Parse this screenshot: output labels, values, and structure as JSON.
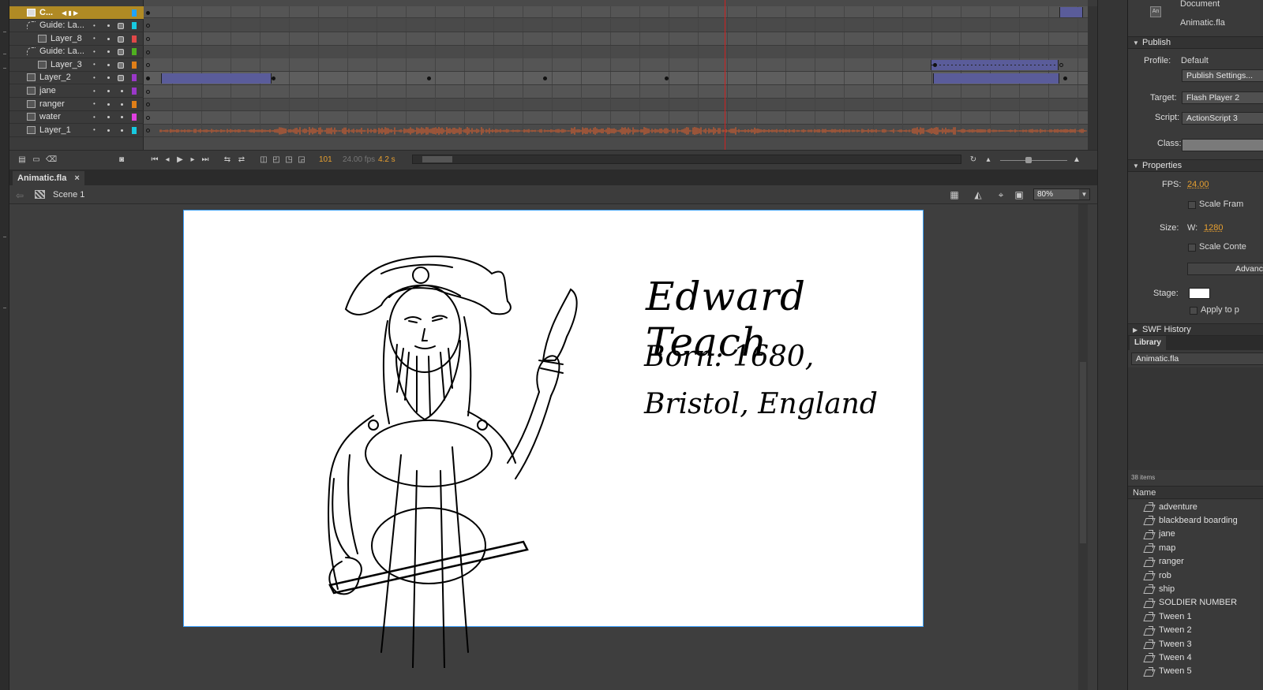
{
  "timeline": {
    "layers": [
      {
        "name": "C...",
        "type": "camera",
        "color": "#1fa3ff",
        "active": true
      },
      {
        "name": "Guide: La...",
        "type": "guide",
        "color": "#17c9e0"
      },
      {
        "name": "Layer_8",
        "type": "layer",
        "color": "#e04848",
        "indent": true
      },
      {
        "name": "Guide: La...",
        "type": "guide",
        "color": "#4fb020"
      },
      {
        "name": "Layer_3",
        "type": "layer",
        "color": "#e07f18",
        "indent": true
      },
      {
        "name": "Layer_2",
        "type": "layer",
        "color": "#9a38c8"
      },
      {
        "name": "jane",
        "type": "layer",
        "color": "#9a38c8"
      },
      {
        "name": "ranger",
        "type": "layer",
        "color": "#e07f18"
      },
      {
        "name": "water",
        "type": "layer",
        "color": "#e040e0"
      },
      {
        "name": "Layer_1",
        "type": "layer",
        "color": "#17c9e0"
      }
    ],
    "current_frame": "101",
    "fps": "24.00 fps",
    "elapsed": "4.2 s"
  },
  "document": {
    "tab_label": "Animatic.fla",
    "close_icon": "close-icon",
    "scene": "Scene 1",
    "zoom": "80%"
  },
  "stage": {
    "title": "Edward Teach",
    "line1": "Born: 1680,",
    "line2": "Bristol, England"
  },
  "panel": {
    "doc_heading": "Document",
    "doc_name": "Animatic.fla",
    "publish": {
      "section": "Publish",
      "profile_label": "Profile:",
      "profile_value": "Default",
      "settings_button": "Publish Settings...",
      "target_label": "Target:",
      "target_value": "Flash Player 2",
      "script_label": "Script:",
      "script_value": "ActionScript 3",
      "class_label": "Class:"
    },
    "properties": {
      "section": "Properties",
      "fps_label": "FPS:",
      "fps_value": "24.00",
      "scale_frames": "Scale Fram",
      "size_label": "Size:",
      "w_label": "W:",
      "w_value": "1280",
      "scale_content": "Scale Conte",
      "advanced_button": "Advanc",
      "stage_label": "Stage:",
      "apply_label": "Apply to p"
    },
    "swf_history": "SWF History",
    "library": {
      "tab": "Library",
      "source": "Animatic.fla",
      "count": "38 items",
      "column": "Name",
      "items": [
        "adventure",
        "blackbeard boarding",
        "jane",
        "map",
        "ranger",
        "rob",
        "ship",
        "SOLDIER NUMBER",
        "Tween 1",
        "Tween 2",
        "Tween 3",
        "Tween 4",
        "Tween 5"
      ]
    }
  },
  "colors": {
    "active_layer": "#b08a24",
    "playhead": "#d02020",
    "tween": "#5a5c9a",
    "waveform": "#e8602a",
    "stage_border": "#3aa0ff",
    "accent_value": "#e8a030"
  }
}
